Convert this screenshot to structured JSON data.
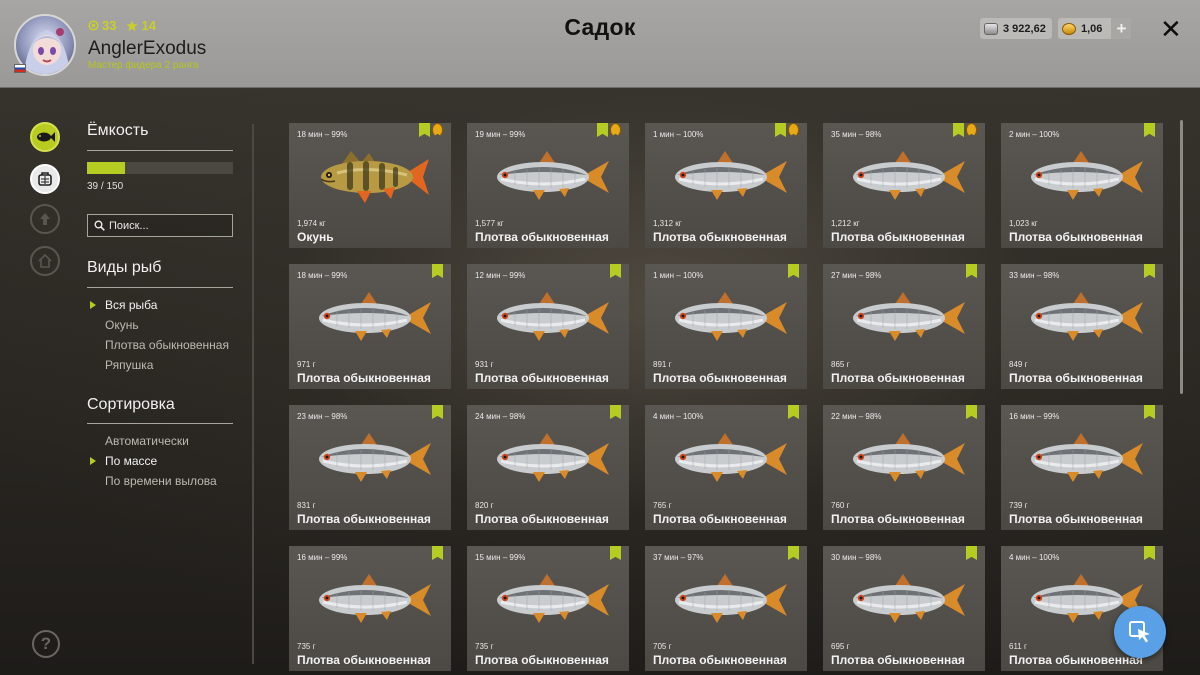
{
  "header": {
    "title": "Садок",
    "player": {
      "level": "33",
      "stars": "14",
      "name": "AnglerExodus",
      "rank": "Мастер фидера 2 ранга"
    },
    "currency": {
      "silver": "3 922,62",
      "gold": "1,06"
    }
  },
  "sidebar": {
    "capacity_title": "Ёмкость",
    "capacity_text": "39 / 150",
    "capacity_fraction": 0.26,
    "search_placeholder": "Поиск...",
    "species_title": "Виды рыб",
    "species": [
      "Вся рыба",
      "Окунь",
      "Плотва обыкновенная",
      "Ряпушка"
    ],
    "species_selected": 0,
    "sort_title": "Сортировка",
    "sort": [
      "Автоматически",
      "По массе",
      "По времени вылова"
    ],
    "sort_selected": 1
  },
  "fish": [
    {
      "time": "18 мин – 99%",
      "weight": "1,974 кг",
      "name": "Окунь",
      "species": "perch",
      "badges": [
        "green",
        "gold"
      ]
    },
    {
      "time": "19 мин – 99%",
      "weight": "1,577 кг",
      "name": "Плотва обыкновенная",
      "species": "roach",
      "badges": [
        "green",
        "gold"
      ]
    },
    {
      "time": "1 мин – 100%",
      "weight": "1,312 кг",
      "name": "Плотва обыкновенная",
      "species": "roach",
      "badges": [
        "green",
        "gold"
      ]
    },
    {
      "time": "35 мин – 98%",
      "weight": "1,212 кг",
      "name": "Плотва обыкновенная",
      "species": "roach",
      "badges": [
        "green",
        "gold"
      ]
    },
    {
      "time": "2 мин – 100%",
      "weight": "1,023 кг",
      "name": "Плотва обыкновенная",
      "species": "roach",
      "badges": [
        "green"
      ]
    },
    {
      "time": "18 мин – 99%",
      "weight": "971 г",
      "name": "Плотва обыкновенная",
      "species": "roach",
      "badges": [
        "green"
      ]
    },
    {
      "time": "12 мин – 99%",
      "weight": "931 г",
      "name": "Плотва обыкновенная",
      "species": "roach",
      "badges": [
        "green"
      ]
    },
    {
      "time": "1 мин – 100%",
      "weight": "891 г",
      "name": "Плотва обыкновенная",
      "species": "roach",
      "badges": [
        "green"
      ]
    },
    {
      "time": "27 мин – 98%",
      "weight": "865 г",
      "name": "Плотва обыкновенная",
      "species": "roach",
      "badges": [
        "green"
      ]
    },
    {
      "time": "33 мин – 98%",
      "weight": "849 г",
      "name": "Плотва обыкновенная",
      "species": "roach",
      "badges": [
        "green"
      ]
    },
    {
      "time": "23 мин – 98%",
      "weight": "831 г",
      "name": "Плотва обыкновенная",
      "species": "roach",
      "badges": [
        "green"
      ]
    },
    {
      "time": "24 мин – 98%",
      "weight": "820 г",
      "name": "Плотва обыкновенная",
      "species": "roach",
      "badges": [
        "green"
      ]
    },
    {
      "time": "4 мин – 100%",
      "weight": "765 г",
      "name": "Плотва обыкновенная",
      "species": "roach",
      "badges": [
        "green"
      ]
    },
    {
      "time": "22 мин – 98%",
      "weight": "760 г",
      "name": "Плотва обыкновенная",
      "species": "roach",
      "badges": [
        "green"
      ]
    },
    {
      "time": "16 мин – 99%",
      "weight": "739 г",
      "name": "Плотва обыкновенная",
      "species": "roach",
      "badges": [
        "green"
      ]
    },
    {
      "time": "16 мин – 99%",
      "weight": "735 г",
      "name": "Плотва обыкновенная",
      "species": "roach",
      "badges": [
        "green"
      ]
    },
    {
      "time": "15 мин – 99%",
      "weight": "735 г",
      "name": "Плотва обыкновенная",
      "species": "roach",
      "badges": [
        "green"
      ]
    },
    {
      "time": "37 мин – 97%",
      "weight": "705 г",
      "name": "Плотва обыкновенная",
      "species": "roach",
      "badges": [
        "green"
      ]
    },
    {
      "time": "30 мин – 98%",
      "weight": "695 г",
      "name": "Плотва обыкновенная",
      "species": "roach",
      "badges": [
        "green"
      ]
    },
    {
      "time": "4 мин – 100%",
      "weight": "611 г",
      "name": "Плотва обыкновенная",
      "species": "roach",
      "badges": [
        "green"
      ]
    }
  ],
  "icons": {
    "rail": [
      "fish-icon",
      "keepnet-icon",
      "hook-icon",
      "home-icon"
    ],
    "help": "?"
  },
  "colors": {
    "accent": "#b7cc22",
    "gold_badge": "#e7a915",
    "fab": "#5aa0e6"
  }
}
